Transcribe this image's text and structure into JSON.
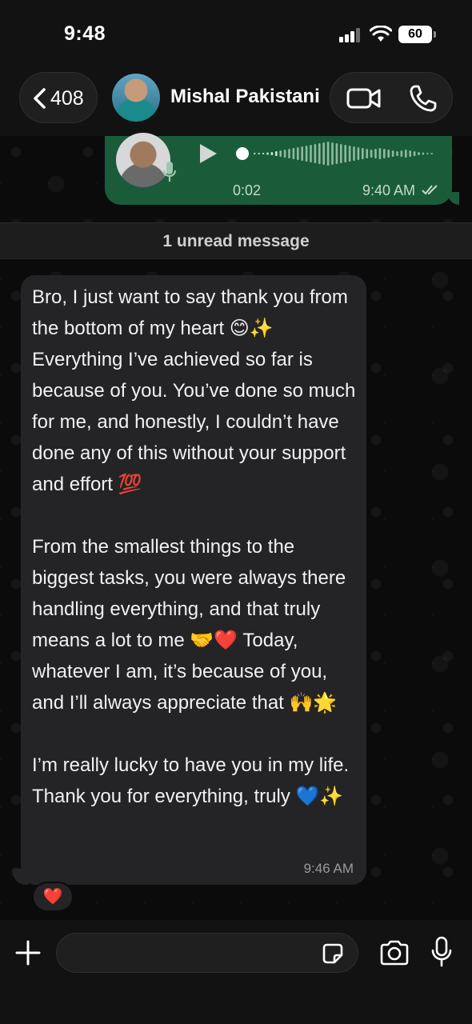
{
  "status_bar": {
    "time": "9:48",
    "battery": "60"
  },
  "header": {
    "back_count": "408",
    "contact_name": "Mishal Pakistani",
    "icons": [
      "chevron-left-icon",
      "video-call-icon",
      "phone-icon"
    ]
  },
  "voice_message": {
    "duration": "0:02",
    "time": "9:40 AM",
    "status": "read",
    "bubble_color": "#1a5c3a"
  },
  "divider": {
    "text": "1 unread message"
  },
  "incoming_message": {
    "paragraphs": [
      "Bro, I just want to say thank you from the bottom of my heart 😊✨ Everything I’ve achieved so far is because of you. You’ve done so much for me, and honestly, I couldn’t have done any of this without your support and effort 💯",
      "From the smallest things to the biggest tasks, you were always there handling everything, and that truly means a lot to me 🤝❤️ Today, whatever I am, it’s because of you, and I’ll always appreciate that 🙌🌟",
      "I’m really lucky to have you in my life. Thank you for everything, truly 💙✨"
    ],
    "time": "9:46 AM",
    "reaction": "❤️"
  },
  "composer": {
    "placeholder": "",
    "icons": [
      "plus-icon",
      "sticker-icon",
      "camera-icon",
      "microphone-icon"
    ]
  },
  "colors": {
    "accent": "#25d366",
    "incoming_bubble": "#242426",
    "background": "#0b0b0b"
  }
}
